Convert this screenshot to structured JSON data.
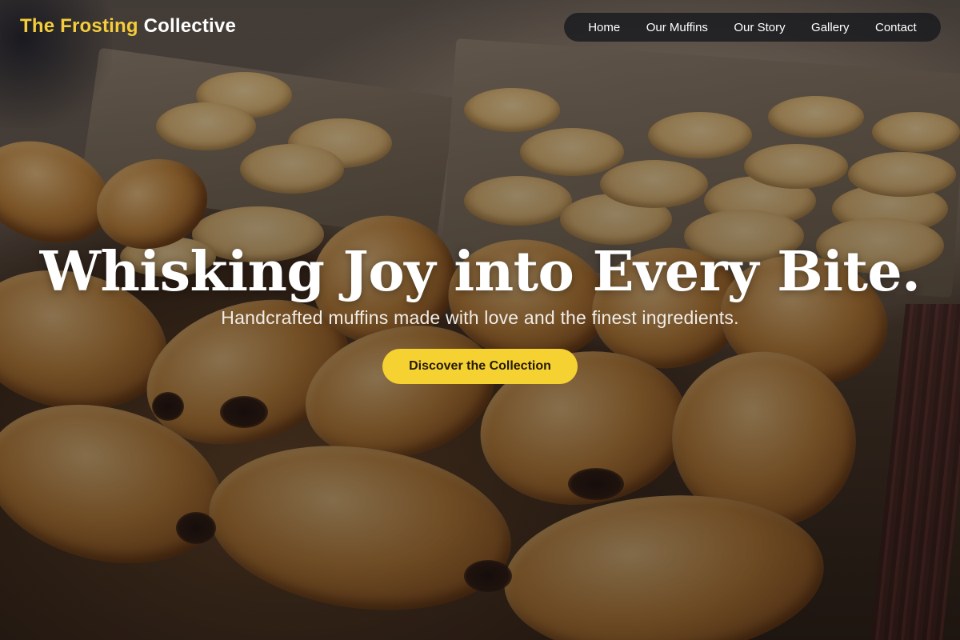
{
  "brand": {
    "accent": "The Frosting",
    "name": "Collective",
    "accent_color": "#f5cd3a"
  },
  "nav": {
    "items": [
      {
        "label": "Home"
      },
      {
        "label": "Our Muffins"
      },
      {
        "label": "Our Story"
      },
      {
        "label": "Gallery"
      },
      {
        "label": "Contact"
      }
    ]
  },
  "hero": {
    "title": "Whisking Joy into Every Bite.",
    "subtitle": "Handcrafted muffins made with love and the finest ingredients.",
    "cta_label": "Discover the Collection",
    "cta_color": "#f6d132",
    "background": "bakery-pastry-tray-photo"
  }
}
